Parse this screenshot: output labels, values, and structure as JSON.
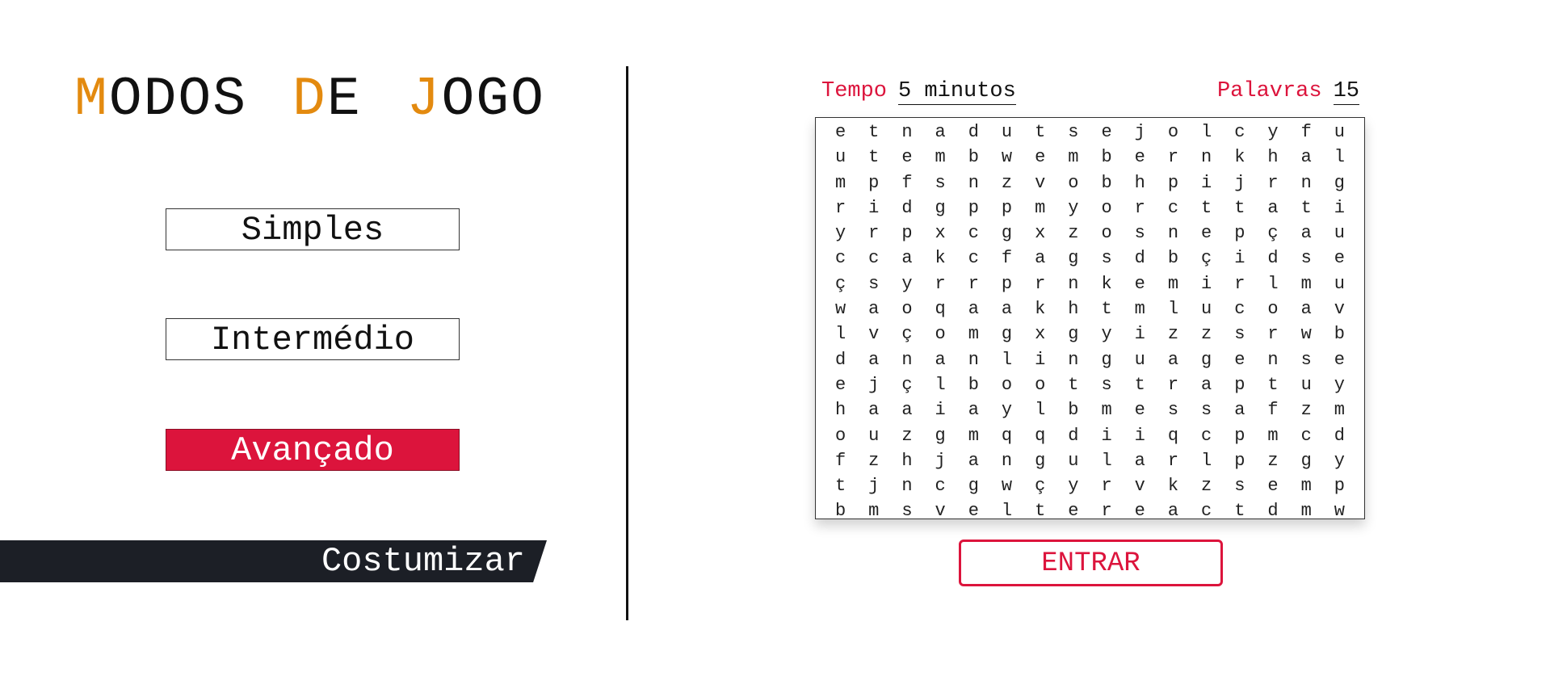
{
  "title": {
    "words": [
      {
        "first": "M",
        "rest": "ODOS"
      },
      {
        "first": "D",
        "rest": "E"
      },
      {
        "first": "J",
        "rest": "OGO"
      }
    ]
  },
  "modes": {
    "simples": "Simples",
    "intermedio": "Intermédio",
    "avancado": "Avançado",
    "selected": "avancado"
  },
  "custom_label": "Costumizar",
  "info": {
    "tempo_label": "Tempo",
    "tempo_value": "5 minutos",
    "palavras_label": "Palavras",
    "palavras_value": "15"
  },
  "grid": [
    [
      "e",
      "t",
      "n",
      "a",
      "d",
      "u",
      "t",
      "s",
      "e",
      "j",
      "o",
      "l",
      "c",
      "y",
      "f",
      "u"
    ],
    [
      "u",
      "t",
      "e",
      "m",
      "b",
      "w",
      "e",
      "m",
      "b",
      "e",
      "r",
      "n",
      "k",
      "h",
      "a",
      "l"
    ],
    [
      "m",
      "p",
      "f",
      "s",
      "n",
      "z",
      "v",
      "o",
      "b",
      "h",
      "p",
      "i",
      "j",
      "r",
      "n",
      "g"
    ],
    [
      "r",
      "i",
      "d",
      "g",
      "p",
      "p",
      "m",
      "y",
      "o",
      "r",
      "c",
      "t",
      "t",
      "a",
      "t",
      "i"
    ],
    [
      "y",
      "r",
      "p",
      "x",
      "c",
      "g",
      "x",
      "z",
      "o",
      "s",
      "n",
      "e",
      "p",
      "ç",
      "a",
      "u"
    ],
    [
      "c",
      "c",
      "a",
      "k",
      "c",
      "f",
      "a",
      "g",
      "s",
      "d",
      "b",
      "ç",
      "i",
      "d",
      "s",
      "e"
    ],
    [
      "ç",
      "s",
      "y",
      "r",
      "r",
      "p",
      "r",
      "n",
      "k",
      "e",
      "m",
      "i",
      "r",
      "l",
      "m",
      "u"
    ],
    [
      "w",
      "a",
      "o",
      "q",
      "a",
      "a",
      "k",
      "h",
      "t",
      "m",
      "l",
      "u",
      "c",
      "o",
      "a",
      "v"
    ],
    [
      "l",
      "v",
      "ç",
      "o",
      "m",
      "g",
      "x",
      "g",
      "y",
      "i",
      "z",
      "z",
      "s",
      "r",
      "w",
      "b"
    ],
    [
      "d",
      "a",
      "n",
      "a",
      "n",
      "l",
      "i",
      "n",
      "g",
      "u",
      "a",
      "g",
      "e",
      "n",
      "s",
      "e"
    ],
    [
      "e",
      "j",
      "ç",
      "l",
      "b",
      "o",
      "o",
      "t",
      "s",
      "t",
      "r",
      "a",
      "p",
      "t",
      "u",
      "y"
    ],
    [
      "h",
      "a",
      "a",
      "i",
      "a",
      "y",
      "l",
      "b",
      "m",
      "e",
      "s",
      "s",
      "a",
      "f",
      "z",
      "m"
    ],
    [
      "o",
      "u",
      "z",
      "g",
      "m",
      "q",
      "q",
      "d",
      "i",
      "i",
      "q",
      "c",
      "p",
      "m",
      "c",
      "d"
    ],
    [
      "f",
      "z",
      "h",
      "j",
      "a",
      "n",
      "g",
      "u",
      "l",
      "a",
      "r",
      "l",
      "p",
      "z",
      "g",
      "y"
    ],
    [
      "t",
      "j",
      "n",
      "c",
      "g",
      "w",
      "ç",
      "y",
      "r",
      "v",
      "k",
      "z",
      "s",
      "e",
      "m",
      "p"
    ],
    [
      "b",
      "m",
      "s",
      "v",
      "e",
      "l",
      "t",
      "e",
      "r",
      "e",
      "a",
      "c",
      "t",
      "d",
      "m",
      "w"
    ]
  ],
  "enter_label": "ENTRAR",
  "colors": {
    "accent_orange": "#e38a0f",
    "accent_red": "#dc143c",
    "dark_bar": "#1c1f26"
  }
}
